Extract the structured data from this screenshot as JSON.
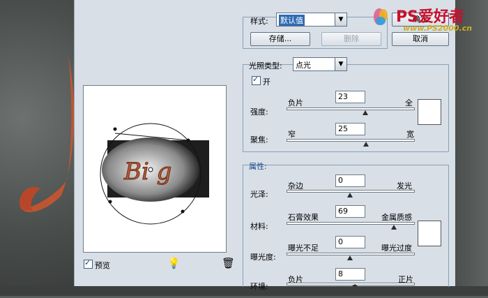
{
  "style_label": "样式:",
  "style_value": "默认值",
  "save_button": "存储...",
  "delete_button": "删除",
  "ok_button": "确定",
  "cancel_button": "取消",
  "light_type_label": "光照类型:",
  "light_type_value": "点光",
  "on_label": "开",
  "intensity": {
    "label": "强度:",
    "left": "负片",
    "right": "全",
    "value": "23"
  },
  "focus": {
    "label": "聚焦:",
    "left": "窄",
    "right": "宽",
    "value": "25"
  },
  "properties_title": "属性:",
  "gloss": {
    "label": "光泽:",
    "left": "杂边",
    "right": "发光",
    "value": "0"
  },
  "material": {
    "label": "材料:",
    "left": "石膏效果",
    "right": "金属质感",
    "value": "69"
  },
  "exposure": {
    "label": "曝光度:",
    "left": "曝光不足",
    "right": "曝光过度",
    "value": "0"
  },
  "ambience": {
    "label": "环境:",
    "left": "负片",
    "right": "正片",
    "value": "8"
  },
  "preview_label": "预览",
  "watermark": "PS爱好者",
  "watermark_url": "www.PS2000.cn",
  "levels": {
    "intensity": 0.62,
    "focus": 0.625,
    "gloss": 0.5,
    "material": 0.845,
    "exposure": 0.5,
    "ambience": 0.54
  }
}
